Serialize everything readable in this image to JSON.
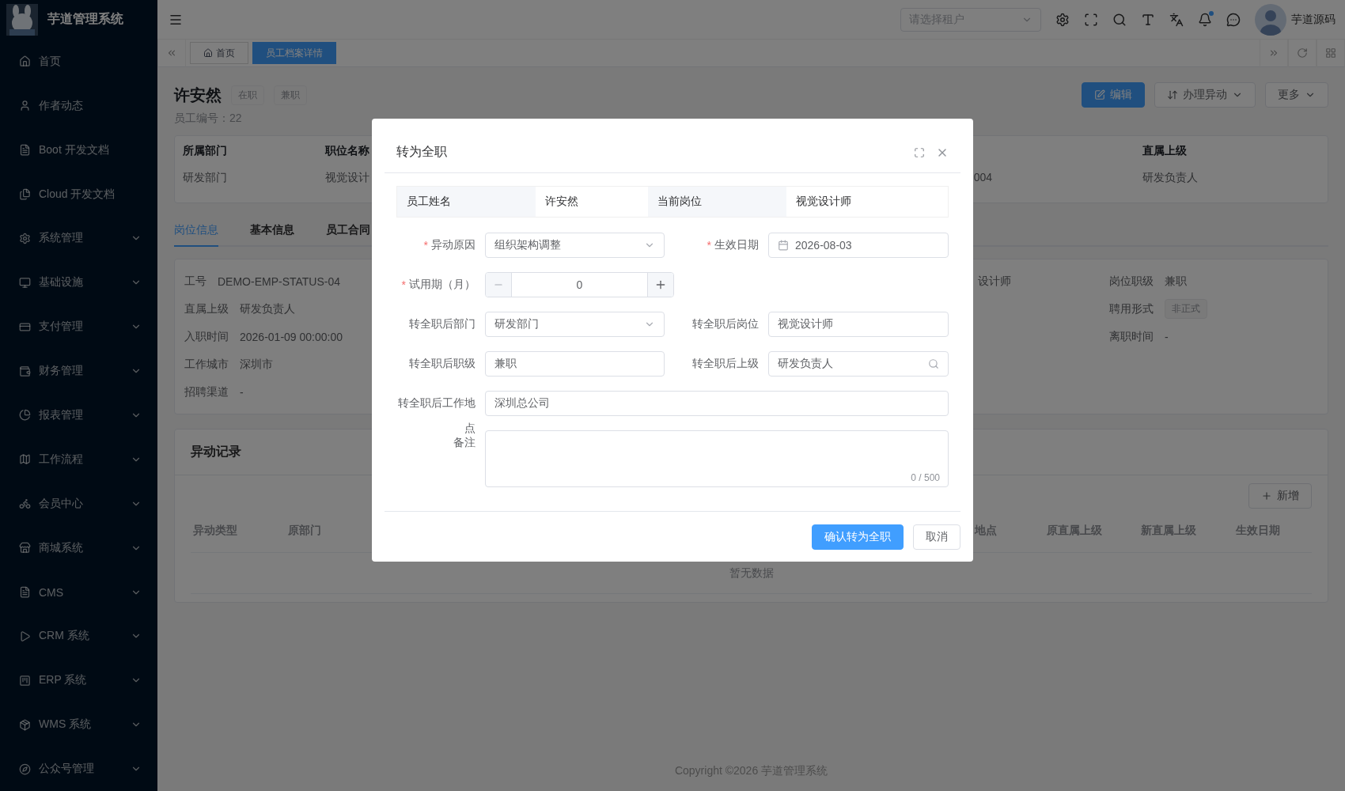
{
  "sidebar": {
    "title": "芋道管理系统",
    "items": [
      {
        "label": "首页",
        "has_children": false
      },
      {
        "label": "作者动态",
        "has_children": false
      },
      {
        "label": "Boot 开发文档",
        "has_children": false
      },
      {
        "label": "Cloud 开发文档",
        "has_children": false
      },
      {
        "label": "系统管理",
        "has_children": true
      },
      {
        "label": "基础设施",
        "has_children": true
      },
      {
        "label": "支付管理",
        "has_children": true
      },
      {
        "label": "财务管理",
        "has_children": true
      },
      {
        "label": "报表管理",
        "has_children": true
      },
      {
        "label": "工作流程",
        "has_children": true
      },
      {
        "label": "会员中心",
        "has_children": true
      },
      {
        "label": "商城系统",
        "has_children": true
      },
      {
        "label": "CMS",
        "has_children": true
      },
      {
        "label": "CRM 系统",
        "has_children": true
      },
      {
        "label": "ERP 系统",
        "has_children": true
      },
      {
        "label": "WMS 系统",
        "has_children": true
      },
      {
        "label": "公众号管理",
        "has_children": true
      }
    ]
  },
  "header": {
    "tenant_placeholder": "请选择租户",
    "user": "芋道源码",
    "notification_dot": true
  },
  "tags": [
    {
      "label": "首页",
      "selected": false
    },
    {
      "label": "员工档案详情",
      "selected": true
    }
  ],
  "employee": {
    "name": "许安然",
    "badges": [
      "在职",
      "兼职"
    ],
    "number": "员工编号：22"
  },
  "actions": [
    {
      "label": "编辑",
      "kind": "primary"
    },
    {
      "label": "办理异动",
      "kind": "dropdown"
    },
    {
      "label": "更多",
      "kind": "dropdown"
    }
  ],
  "summary": {
    "columns": [
      {
        "label": "所属部门",
        "value": "研发部门"
      },
      {
        "label": "职位名称",
        "value": "视觉设计"
      }
    ],
    "partial_value": "004",
    "last_column": {
      "label": "直属上级",
      "value": "研发负责人"
    }
  },
  "tabs": [
    {
      "label": "岗位信息",
      "selected": true
    },
    {
      "label": "基本信息",
      "selected": false
    },
    {
      "label": "员工合同",
      "selected": false
    }
  ],
  "position_info": {
    "left": [
      {
        "label": "工号",
        "value": "DEMO-EMP-STATUS-04"
      },
      {
        "label": "直属上级",
        "value": "研发负责人"
      },
      {
        "label": "入职时间",
        "value": "2026-01-09 00:00:00"
      },
      {
        "label": "工作城市",
        "value": "深圳市"
      },
      {
        "label": "招聘渠道",
        "value": "-"
      }
    ],
    "middle_partial": "设计师",
    "right": [
      {
        "label": "岗位职级",
        "value": "兼职",
        "kind": "text"
      },
      {
        "label": "聘用形式",
        "value": "非正式",
        "kind": "tag"
      },
      {
        "label": "离职时间",
        "value": "-",
        "kind": "text"
      }
    ]
  },
  "records": {
    "title": "异动记录",
    "add_button": "新增",
    "columns_left": [
      "异动类型",
      "原部门"
    ],
    "columns_right": [
      "地点",
      "原直属上级",
      "新直属上级",
      "生效日期"
    ],
    "empty": "暂无数据"
  },
  "footer": "Copyright ©2026 芋道管理系统",
  "dialog": {
    "title": "转为全职",
    "summary": [
      {
        "label": "员工姓名",
        "value": "许安然"
      },
      {
        "label": "当前岗位",
        "value": "视觉设计师"
      }
    ],
    "rows": [
      [
        {
          "label": "异动原因",
          "required": true,
          "kind": "select",
          "value": "组织架构调整"
        },
        {
          "label": "生效日期",
          "required": true,
          "kind": "date",
          "value": "2026-08-03"
        }
      ],
      [
        {
          "label": "试用期（月）",
          "required": true,
          "kind": "number",
          "value": "0"
        }
      ],
      [
        {
          "label": "转全职后部门",
          "required": false,
          "kind": "select",
          "value": "研发部门"
        },
        {
          "label": "转全职后岗位",
          "required": false,
          "kind": "text",
          "value": "视觉设计师"
        }
      ],
      [
        {
          "label": "转全职后职级",
          "required": false,
          "kind": "text",
          "value": "兼职"
        },
        {
          "label": "转全职后上级",
          "required": false,
          "kind": "search",
          "value": "研发负责人"
        }
      ],
      [
        {
          "label": "转全职后工作地",
          "required": false,
          "kind": "text",
          "value": "深圳总公司"
        }
      ],
      [
        {
          "label_lines": [
            "点",
            "备注"
          ],
          "required": false,
          "kind": "textarea",
          "counter": "0 / 500"
        }
      ]
    ],
    "required_mark": "*",
    "buttons": [
      {
        "label": "确认转为全职",
        "kind": "primary"
      },
      {
        "label": "取消",
        "kind": "default"
      }
    ]
  }
}
